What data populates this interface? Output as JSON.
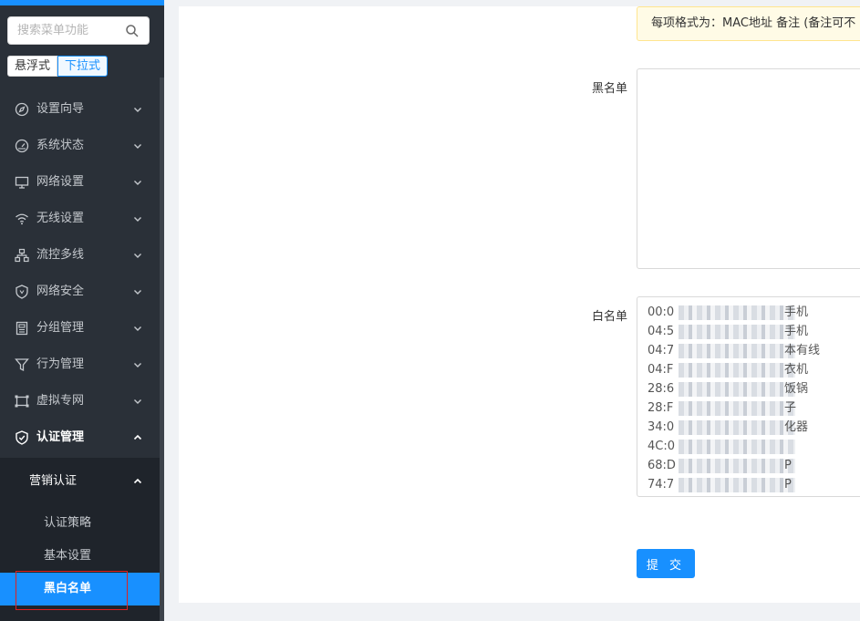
{
  "sidebar": {
    "search": {
      "placeholder": "搜索菜单功能"
    },
    "mode": {
      "float_label": "悬浮式",
      "dropdown_label": "下拉式"
    },
    "menu": [
      {
        "label": "设置向导",
        "icon": "compass-icon"
      },
      {
        "label": "系统状态",
        "icon": "gauge-icon"
      },
      {
        "label": "网络设置",
        "icon": "monitor-icon"
      },
      {
        "label": "无线设置",
        "icon": "wifi-icon"
      },
      {
        "label": "流控多线",
        "icon": "network-tree-icon"
      },
      {
        "label": "网络安全",
        "icon": "shield-icon"
      },
      {
        "label": "分组管理",
        "icon": "group-icon"
      },
      {
        "label": "行为管理",
        "icon": "filter-icon"
      },
      {
        "label": "虚拟专网",
        "icon": "vpn-icon"
      },
      {
        "label": "认证管理",
        "icon": "shield-check-icon",
        "expanded": true
      }
    ],
    "submenu": {
      "group_label": "营销认证",
      "items": [
        {
          "label": "认证策略"
        },
        {
          "label": "基本设置"
        },
        {
          "label": "黑白名单",
          "selected": true
        }
      ]
    }
  },
  "main": {
    "notice": "每项格式为：MAC地址 备注 (备注可不",
    "blacklist": {
      "label": "黑名单",
      "value": ""
    },
    "whitelist": {
      "label": "白名单",
      "lines": [
        {
          "prefix": "00:0",
          "suffix": "手机"
        },
        {
          "prefix": "04:5",
          "suffix": "手机"
        },
        {
          "prefix": "04:7",
          "suffix": "本有线"
        },
        {
          "prefix": "04:F",
          "suffix": "衣机"
        },
        {
          "prefix": "28:6",
          "suffix": "饭锅"
        },
        {
          "prefix": "28:F",
          "suffix": "子"
        },
        {
          "prefix": "34:0",
          "suffix": "化器"
        },
        {
          "prefix": "4C:0",
          "suffix": ""
        },
        {
          "prefix": "68:D",
          "suffix": "P"
        },
        {
          "prefix": "74:7",
          "suffix": "P"
        }
      ]
    },
    "submit_label": "提 交"
  },
  "colors": {
    "accent": "#1890ff",
    "sidebar_bg": "#2a3038",
    "highlight_border": "#e02020"
  }
}
